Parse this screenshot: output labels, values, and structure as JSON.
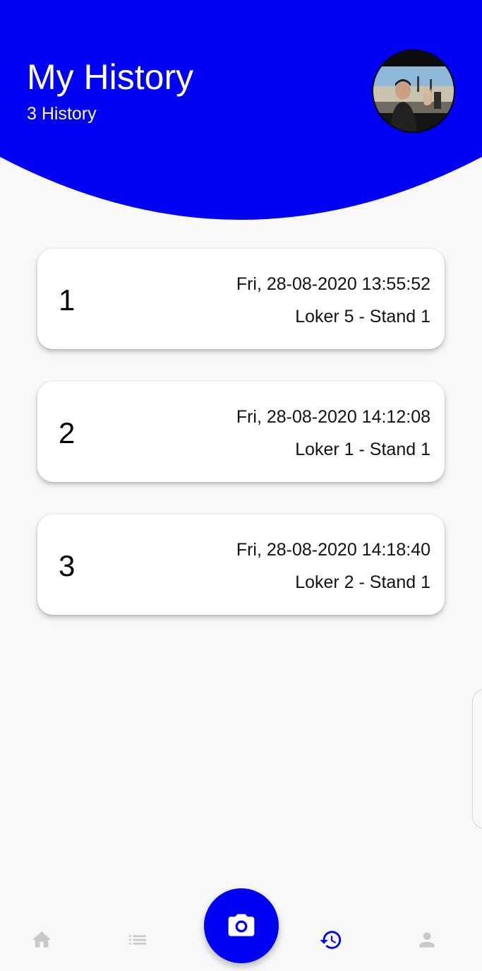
{
  "theme": {
    "primary": "#0000f2",
    "background": "#f8f8f8",
    "nav_inactive": "#c9c9c9"
  },
  "header": {
    "title": "My History",
    "subtitle": "3 History",
    "avatar_icon": "user-photo"
  },
  "history": [
    {
      "number": "1",
      "datetime": "Fri, 28-08-2020 13:55:52",
      "location": "Loker 5 - Stand 1"
    },
    {
      "number": "2",
      "datetime": "Fri, 28-08-2020 14:12:08",
      "location": "Loker 1 - Stand 1"
    },
    {
      "number": "3",
      "datetime": "Fri, 28-08-2020 14:18:40",
      "location": "Loker 2 - Stand 1"
    }
  ],
  "bottom_nav": {
    "items": [
      {
        "icon": "home-icon",
        "active": false
      },
      {
        "icon": "list-icon",
        "active": false
      },
      {
        "icon": "camera-icon",
        "active": false
      },
      {
        "icon": "history-icon",
        "active": true
      },
      {
        "icon": "person-icon",
        "active": false
      }
    ]
  }
}
